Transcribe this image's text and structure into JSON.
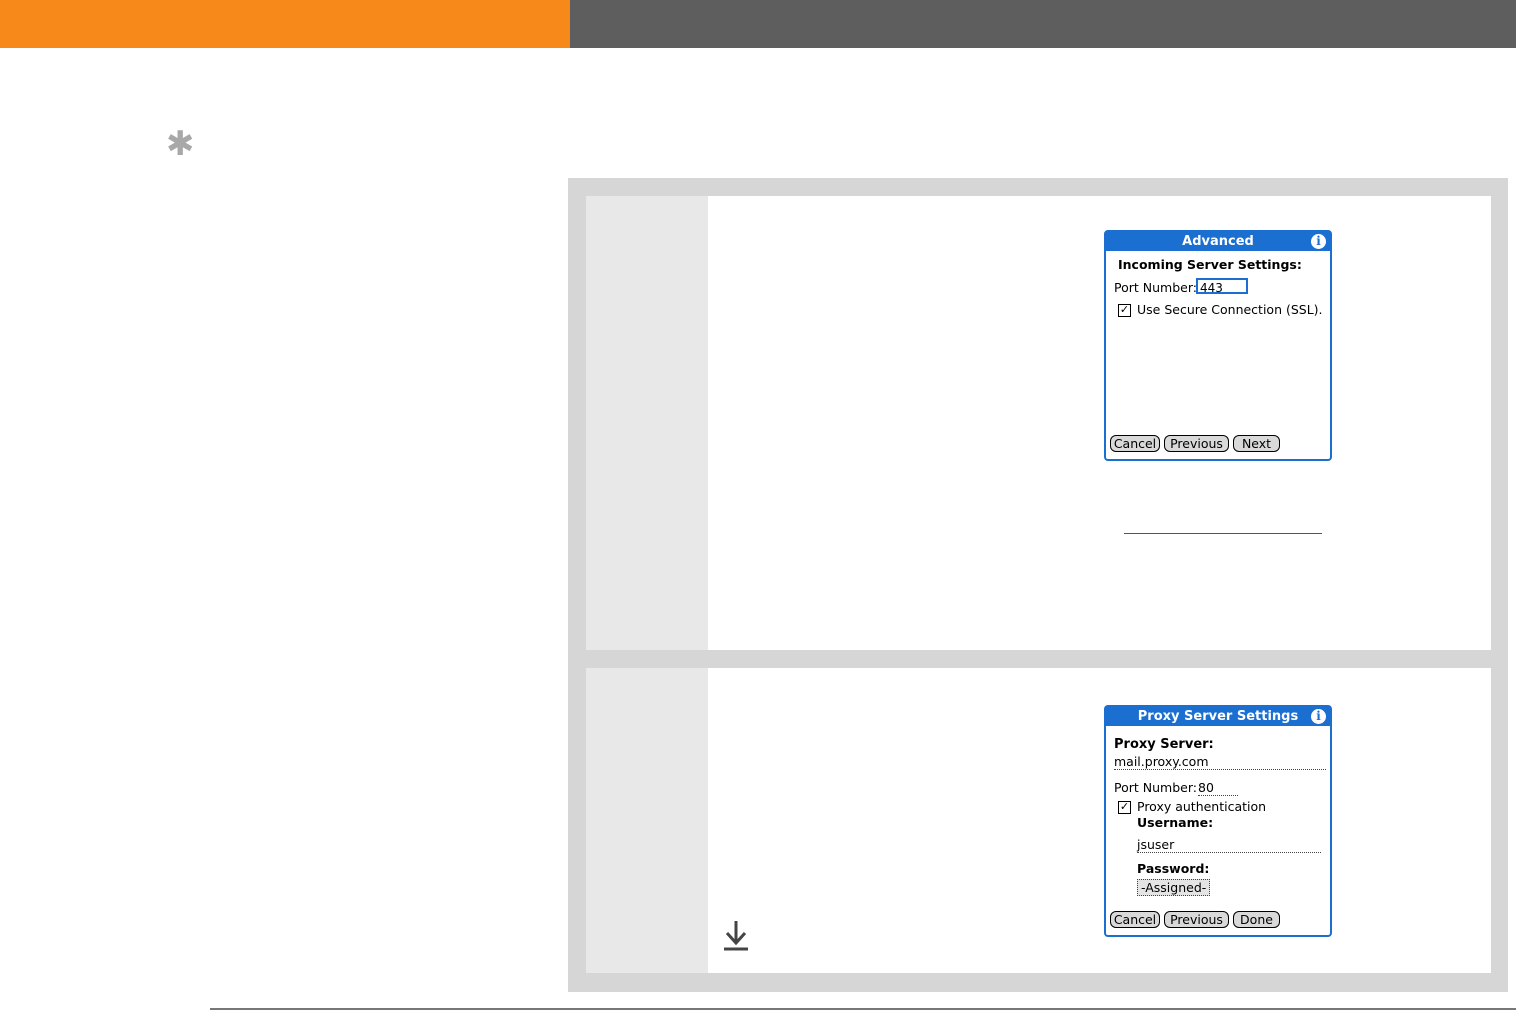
{
  "header": {
    "accent_color": "#f7891b",
    "bar_color": "#5e5e5e"
  },
  "tip": {
    "icon": "asterisk-icon"
  },
  "step1": {
    "screen": {
      "title": "Advanced",
      "section_label": "Incoming Server Settings:",
      "port_label": "Port Number:",
      "port_value": "443",
      "ssl_checked": true,
      "ssl_label": "Use Secure Connection (SSL).",
      "buttons": [
        "Cancel",
        "Previous",
        "Next"
      ]
    }
  },
  "step2": {
    "screen": {
      "title": "Proxy Server Settings",
      "proxy_server_label": "Proxy Server:",
      "proxy_server_value": "mail.proxy.com",
      "port_label": "Port Number:",
      "port_value": "80",
      "auth_checked": true,
      "auth_label": "Proxy authentication",
      "username_label": "Username:",
      "username_value": "jsuser",
      "password_label": "Password:",
      "password_value": "-Assigned-",
      "buttons": [
        "Cancel",
        "Previous",
        "Done"
      ]
    },
    "continue_icon": "down-arrow-icon"
  },
  "colors": {
    "palm_blue": "#1a6fd0",
    "panel_gray": "#d6d6d6",
    "step_col": "#e8e8e8"
  }
}
